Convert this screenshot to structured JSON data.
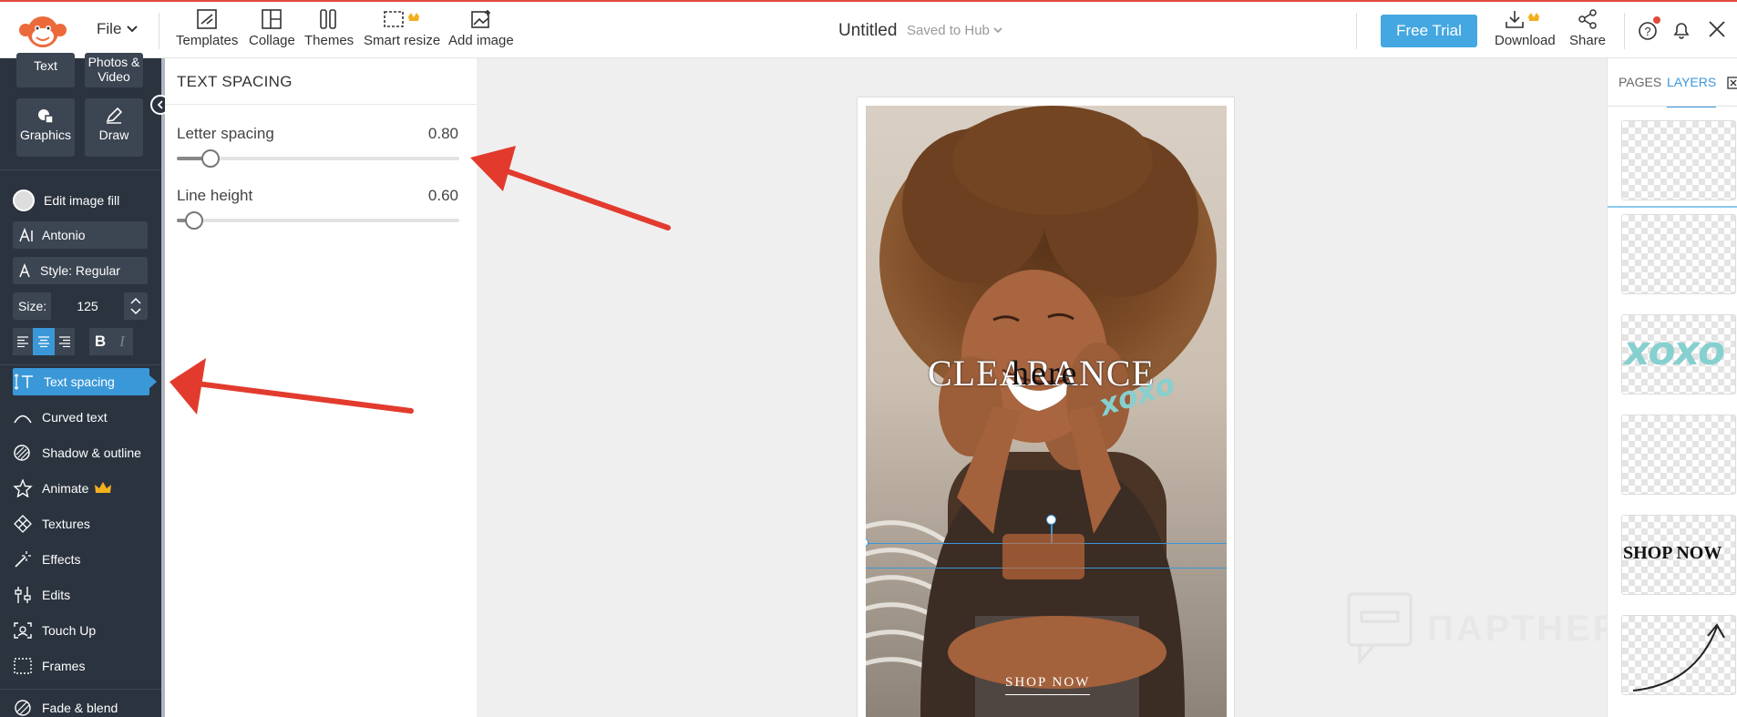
{
  "topbar": {
    "file_label": "File",
    "tools": [
      {
        "label": "Templates",
        "icon": "templates-icon"
      },
      {
        "label": "Collage",
        "icon": "collage-icon"
      },
      {
        "label": "Themes",
        "icon": "themes-icon"
      },
      {
        "label": "Smart resize",
        "icon": "smart-resize-icon"
      },
      {
        "label": "Add image",
        "icon": "add-image-icon"
      }
    ],
    "doc_title": "Untitled",
    "saved_status": "Saved to Hub",
    "free_trial_label": "Free Trial",
    "download_label": "Download",
    "share_label": "Share"
  },
  "sidebar": {
    "tiles": [
      {
        "label": "Text",
        "icon": "text-icon"
      },
      {
        "label": "Photos & Video",
        "icon": "photos-icon"
      },
      {
        "label": "Graphics",
        "icon": "graphics-icon"
      },
      {
        "label": "Draw",
        "icon": "draw-icon"
      }
    ],
    "edit_fill_label": "Edit image fill",
    "font_name": "Antonio",
    "style_label": "Style: Regular",
    "size_label": "Size:",
    "size_value": "125",
    "items": [
      {
        "label": "Text spacing",
        "icon": "text-spacing-icon",
        "active": true
      },
      {
        "label": "Curved text",
        "icon": "curved-text-icon"
      },
      {
        "label": "Shadow & outline",
        "icon": "shadow-outline-icon"
      },
      {
        "label": "Animate",
        "icon": "animate-icon",
        "premium": true
      },
      {
        "label": "Textures",
        "icon": "textures-icon"
      },
      {
        "label": "Effects",
        "icon": "effects-icon"
      },
      {
        "label": "Edits",
        "icon": "edits-icon"
      },
      {
        "label": "Touch Up",
        "icon": "touch-up-icon"
      },
      {
        "label": "Frames",
        "icon": "frames-icon"
      },
      {
        "label": "Fade & blend",
        "icon": "fade-blend-icon"
      }
    ]
  },
  "panel": {
    "title": "TEXT SPACING",
    "letter_spacing": {
      "label": "Letter spacing",
      "value": "0.80",
      "fraction": 0.12
    },
    "line_height": {
      "label": "Line height",
      "value": "0.60",
      "fraction": 0.06
    }
  },
  "canvas": {
    "headline_text": "CLEARANCE",
    "overlay_text": "here",
    "script_text": "xoxo",
    "cta_text": "SHOP NOW"
  },
  "layers_panel": {
    "tab_pages": "PAGES",
    "tab_layers": "LAYERS",
    "xoxo_text": "xoxo",
    "shop_now_text": "SHOP NOW"
  },
  "watermark": "ПАРТНЕРКИН",
  "colors": {
    "accent_blue": "#44a7e2",
    "sidebar_bg": "#2b333f",
    "active_item": "#3a98d8",
    "arrow_red": "#e23b2e",
    "brand_orange": "#ec6a3a"
  }
}
